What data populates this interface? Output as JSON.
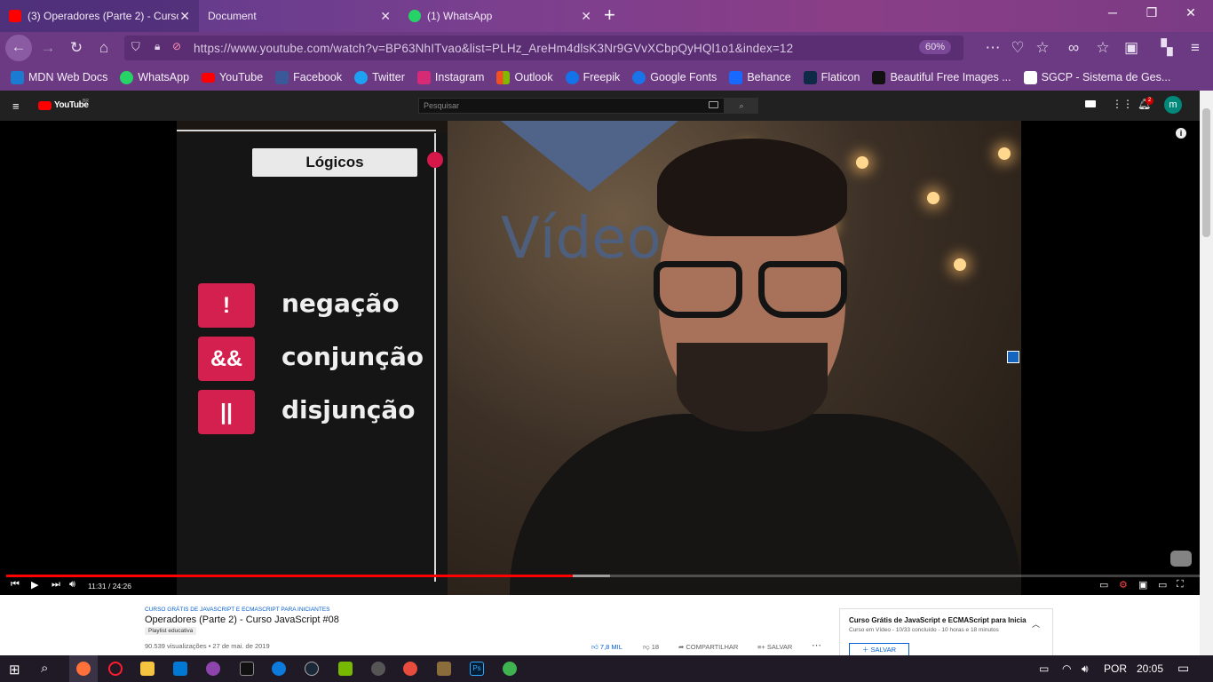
{
  "browser": {
    "tabs": [
      {
        "title": "(3) Operadores (Parte 2) - Curso",
        "active": true,
        "favicon_color": "#ff0000"
      },
      {
        "title": "Document",
        "active": false,
        "favicon_color": ""
      },
      {
        "title": "(1) WhatsApp",
        "active": false,
        "favicon_color": "#25d366"
      }
    ],
    "new_tab": "+",
    "url": "https://www.youtube.com/watch?v=BP63NhITvao&list=PLHz_AreHm4dlsK3Nr9GVvXCbpQyHQl1o1&index=12",
    "zoom": "60%",
    "bookmarks": [
      {
        "label": "MDN Web Docs",
        "icon": "mdn-icon",
        "color": "#1b7bd1"
      },
      {
        "label": "WhatsApp",
        "icon": "whatsapp-icon",
        "color": "#25d366"
      },
      {
        "label": "YouTube",
        "icon": "youtube-icon",
        "color": "#ff0000"
      },
      {
        "label": "Facebook",
        "icon": "facebook-icon",
        "color": "#3b5998"
      },
      {
        "label": "Twitter",
        "icon": "twitter-icon",
        "color": "#1da1f2"
      },
      {
        "label": "Instagram",
        "icon": "instagram-icon",
        "color": "#d62976"
      },
      {
        "label": "Outlook",
        "icon": "outlook-icon",
        "color": "#f25022"
      },
      {
        "label": "Freepik",
        "icon": "freepik-icon",
        "color": "#1273eb"
      },
      {
        "label": "Google Fonts",
        "icon": "google-fonts-icon",
        "color": "#1a73e8"
      },
      {
        "label": "Behance",
        "icon": "behance-icon",
        "color": "#1769ff"
      },
      {
        "label": "Flaticon",
        "icon": "flaticon-icon",
        "color": "#0e2a47"
      },
      {
        "label": "Beautiful Free Images ...",
        "icon": "unsplash-icon",
        "color": "#111111"
      },
      {
        "label": "SGCP - Sistema de Ges...",
        "icon": "sgcp-icon",
        "color": "#ffffff"
      }
    ]
  },
  "youtube": {
    "logo": "YouTube",
    "region": "BR",
    "search_placeholder": "Pesquisar",
    "notifications_count": "2",
    "avatar_letter": "m",
    "video": {
      "panel_title": "Lógicos",
      "operators": [
        {
          "symbol": "!",
          "word": "negação"
        },
        {
          "symbol": "&&",
          "word": "conjunção"
        },
        {
          "symbol": "||",
          "word": "disjunção"
        }
      ],
      "background_word": "Vídeo"
    },
    "player": {
      "time_current": "11:31",
      "time_total": "24:26",
      "time_display": "11:31 / 24:26",
      "progress_fraction": 0.4717
    },
    "below": {
      "crumb": "CURSO GRÁTIS DE JAVASCRIPT E ECMASCRIPT PARA INICIANTES",
      "title": "Operadores (Parte 2) - Curso JavaScript #08",
      "playlist_tag": "Playlist educativa",
      "meta": "90.539 visualizações • 27 de mai. de 2019",
      "likes": "7,8 MIL",
      "dislikes": "18",
      "share": "COMPARTILHAR",
      "save": "SALVAR",
      "playlist_box": {
        "title": "Curso Grátis de JavaScript e ECMAScript para Iniciar",
        "subtitle": "Curso em Vídeo - 10/33 concluído - 10 horas e 18 minutos",
        "save_button": "SALVAR"
      }
    }
  },
  "taskbar": {
    "language": "POR",
    "clock": "20:05"
  }
}
